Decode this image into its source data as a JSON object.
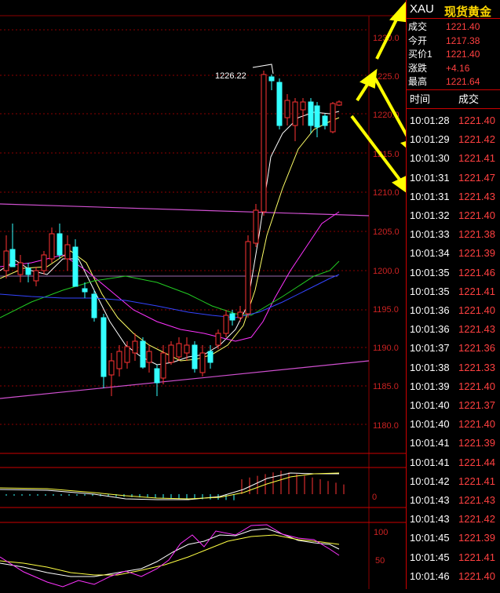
{
  "header": {
    "symbol": "XAU",
    "name": "现货黄金"
  },
  "quote": [
    {
      "label": "成交",
      "value": "1221.40"
    },
    {
      "label": "今开",
      "value": "1217.38"
    },
    {
      "label": "买价1",
      "value": "1221.40"
    },
    {
      "label": "涨跌",
      "value": "+4.16"
    },
    {
      "label": "最高",
      "value": "1221.64"
    }
  ],
  "tick_table": {
    "col_time": "时间",
    "col_deal": "成交",
    "rows": [
      {
        "time": "10:01:28",
        "price": "1221.40"
      },
      {
        "time": "10:01:29",
        "price": "1221.42"
      },
      {
        "time": "10:01:30",
        "price": "1221.41"
      },
      {
        "time": "10:01:31",
        "price": "1221.47"
      },
      {
        "time": "10:01:31",
        "price": "1221.43"
      },
      {
        "time": "10:01:32",
        "price": "1221.40"
      },
      {
        "time": "10:01:33",
        "price": "1221.38"
      },
      {
        "time": "10:01:34",
        "price": "1221.39"
      },
      {
        "time": "10:01:35",
        "price": "1221.46"
      },
      {
        "time": "10:01:35",
        "price": "1221.41"
      },
      {
        "time": "10:01:36",
        "price": "1221.40"
      },
      {
        "time": "10:01:36",
        "price": "1221.43"
      },
      {
        "time": "10:01:37",
        "price": "1221.36"
      },
      {
        "time": "10:01:38",
        "price": "1221.33"
      },
      {
        "time": "10:01:39",
        "price": "1221.40"
      },
      {
        "time": "10:01:40",
        "price": "1221.37"
      },
      {
        "time": "10:01:40",
        "price": "1221.40"
      },
      {
        "time": "10:01:41",
        "price": "1221.39"
      },
      {
        "time": "10:01:41",
        "price": "1221.44"
      },
      {
        "time": "10:01:42",
        "price": "1221.41"
      },
      {
        "time": "10:01:43",
        "price": "1221.43"
      },
      {
        "time": "10:01:43",
        "price": "1221.42"
      },
      {
        "time": "10:01:45",
        "price": "1221.39"
      },
      {
        "time": "10:01:45",
        "price": "1221.41"
      },
      {
        "time": "10:01:46",
        "price": "1221.40"
      }
    ]
  },
  "chart": {
    "price_axis": [
      "1230.0",
      "1225.0",
      "1220.0",
      "1215.0",
      "1210.0",
      "1205.0",
      "1200.0",
      "1195.0",
      "1190.0",
      "1185.0",
      "1180.0"
    ],
    "high_label": "1226.22",
    "macd_axis": [
      "0"
    ],
    "kdj_axis": [
      "100",
      "50"
    ],
    "colors": {
      "up": "#ff3333",
      "down": "#33ffff",
      "grid": "#8b0000",
      "arrow": "#ffff00"
    }
  }
}
